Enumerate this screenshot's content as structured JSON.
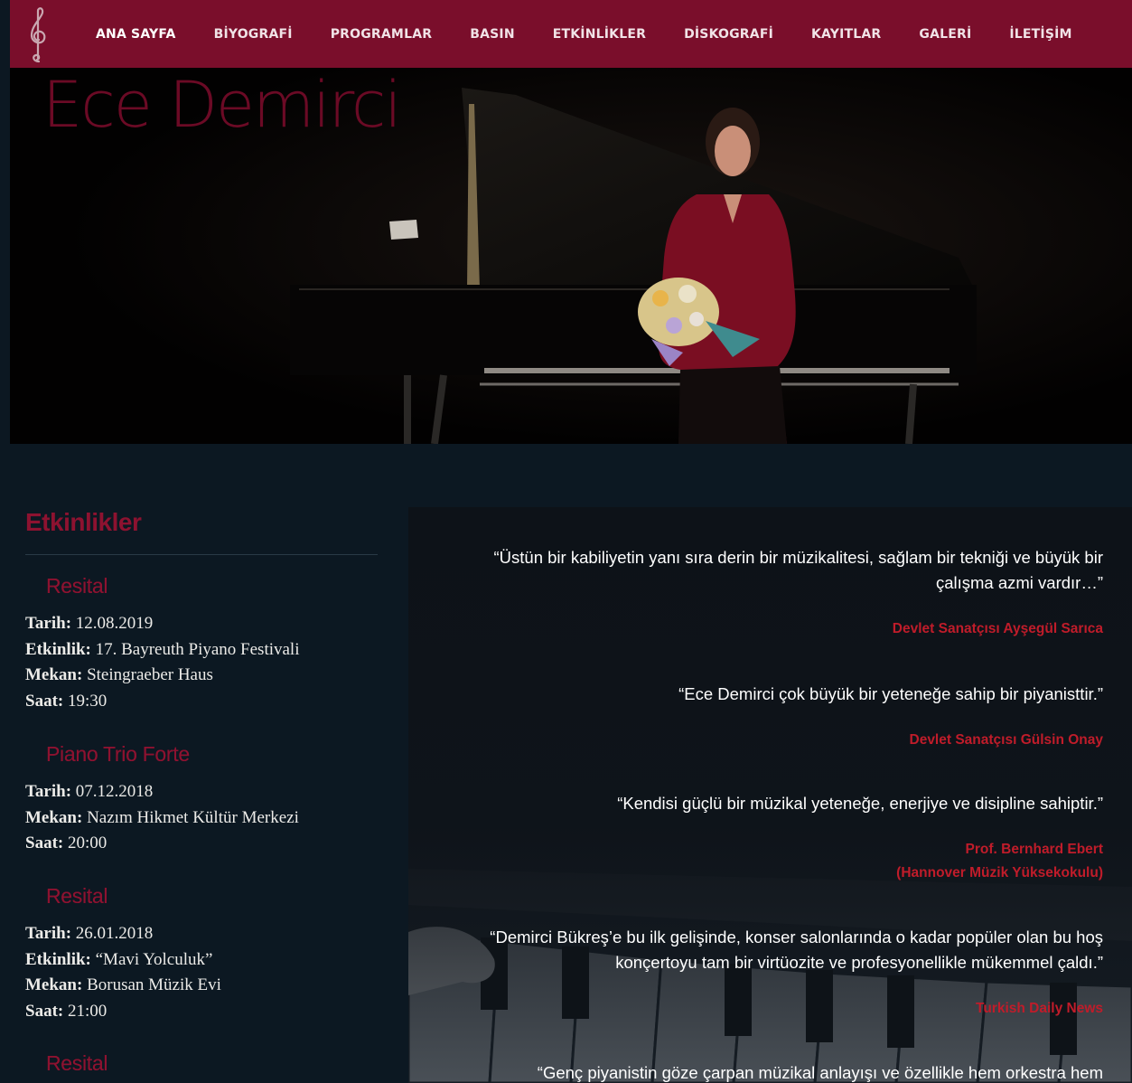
{
  "nav": {
    "logo": "treble-clef-logo",
    "items": [
      {
        "label": "ANA SAYFA"
      },
      {
        "label": "BİYOGRAFİ"
      },
      {
        "label": "PROGRAMLAR"
      },
      {
        "label": "BASIN"
      },
      {
        "label": "ETKİNLİKLER"
      },
      {
        "label": "DİSKOGRAFİ"
      },
      {
        "label": "KAYITLAR"
      },
      {
        "label": "GALERİ"
      },
      {
        "label": "İLETİŞİM"
      }
    ]
  },
  "hero": {
    "title": "Ece Demirci"
  },
  "events": {
    "title": "Etkinlikler",
    "items": [
      {
        "title": "Resital",
        "lines": [
          {
            "label": "Tarih:",
            "value": " 12.08.2019"
          },
          {
            "label": "Etkinlik:",
            "value": " 17. Bayreuth Piyano Festivali"
          },
          {
            "label": "Mekan:",
            "value": " Steingraeber Haus"
          },
          {
            "label": "Saat:",
            "value": " 19:30"
          }
        ]
      },
      {
        "title": "Piano Trio Forte",
        "lines": [
          {
            "label": "Tarih:",
            "value": " 07.12.2018"
          },
          {
            "label": "Mekan:",
            "value": " Nazım Hikmet Kültür Merkezi"
          },
          {
            "label": "Saat:",
            "value": " 20:00"
          }
        ]
      },
      {
        "title": "Resital",
        "lines": [
          {
            "label": "Tarih:",
            "value": " 26.01.2018"
          },
          {
            "label": "Etkinlik:",
            "value": " “Mavi Yolculuk”"
          },
          {
            "label": "Mekan:",
            "value": " Borusan Müzik Evi"
          },
          {
            "label": "Saat:",
            "value": " 21:00"
          }
        ]
      },
      {
        "title": "Resital",
        "lines": []
      }
    ]
  },
  "quotes": [
    {
      "text_lines": [
        "“Üstün bir kabiliyetin yanı sıra derin bir müzikalitesi, sağlam bir tekniği ve büyük bir",
        "çalışma azmi vardır…”"
      ],
      "author_lines": [
        "Devlet Sanatçısı Ayşegül Sarıca"
      ]
    },
    {
      "text_lines": [
        "“Ece Demirci çok büyük bir yeteneğe sahip bir piyanisttir.”"
      ],
      "author_lines": [
        "Devlet Sanatçısı Gülsin Onay"
      ]
    },
    {
      "text_lines": [
        "“Kendisi güçlü bir müzikal yeteneğe, enerjiye ve disipline sahiptir.”"
      ],
      "author_lines": [
        "Prof. Bernhard Ebert",
        "(Hannover Müzik Yüksekokulu)"
      ]
    },
    {
      "text_lines": [
        "“Demirci Bükreş’e bu ilk gelişinde, konser salonlarında o kadar popüler olan bu hoş",
        "konçertoyu tam bir virtüozite ve profesyonellikle mükemmel çaldı.”"
      ],
      "author_lines": [
        "Turkish Daily News"
      ]
    },
    {
      "text_lines": [
        "“Genç piyanistin göze çarpan müzikal anlayışı ve özellikle hem orkestra hem"
      ],
      "author_lines": []
    }
  ],
  "colors": {
    "nav_bg": "#7a0e2b",
    "page_bg": "#0c1822",
    "accent_crimson": "#8d1230",
    "quote_author": "#c01c2a"
  }
}
